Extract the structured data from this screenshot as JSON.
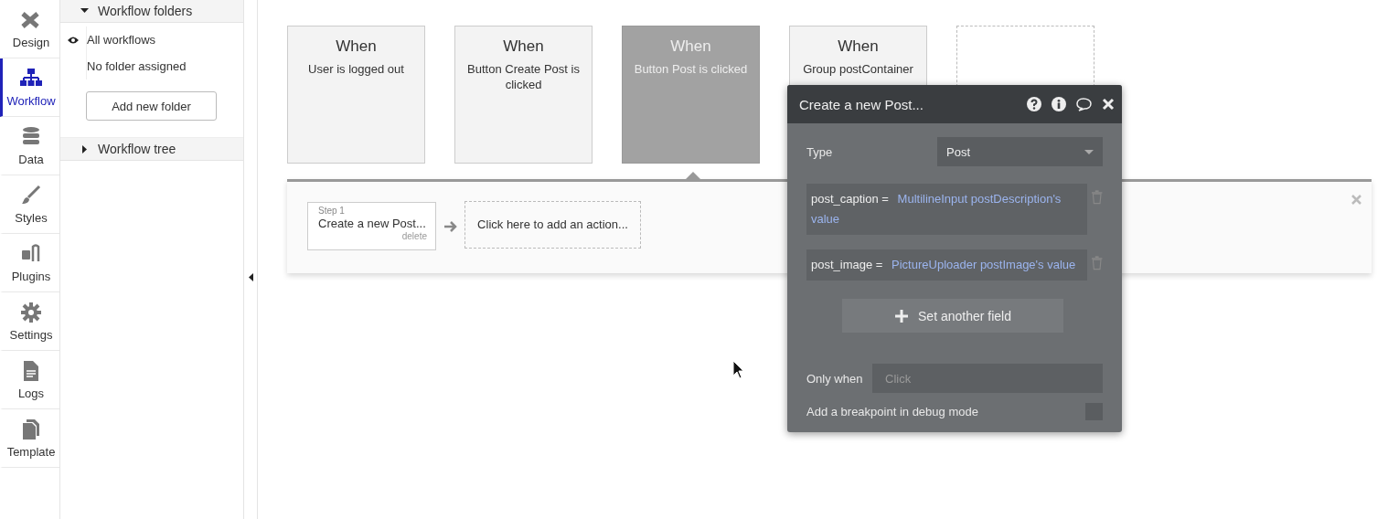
{
  "nav": [
    {
      "label": "Design",
      "selected": false
    },
    {
      "label": "Workflow",
      "selected": true
    },
    {
      "label": "Data",
      "selected": false
    },
    {
      "label": "Styles",
      "selected": false
    },
    {
      "label": "Plugins",
      "selected": false
    },
    {
      "label": "Settings",
      "selected": false
    },
    {
      "label": "Logs",
      "selected": false
    },
    {
      "label": "Template",
      "selected": false
    }
  ],
  "folders_panel": {
    "header": "Workflow folders",
    "expanded": true,
    "items": [
      {
        "label": "All workflows",
        "visible": true
      },
      {
        "label": "No folder assigned",
        "visible": false
      }
    ],
    "add_button": "Add new folder"
  },
  "tree_section": {
    "header": "Workflow tree",
    "expanded": false
  },
  "events": [
    {
      "kind": "event",
      "title": "When",
      "description": "User is logged out",
      "selected": false
    },
    {
      "kind": "event",
      "title": "When",
      "description": "Button Create Post is clicked",
      "selected": false
    },
    {
      "kind": "event",
      "title": "When",
      "description": "Button Post is clicked",
      "selected": true
    },
    {
      "kind": "event",
      "title": "When",
      "description": "Group postContainer",
      "selected": false
    },
    {
      "kind": "add"
    }
  ],
  "workflow": {
    "steps": [
      {
        "label": "Step 1",
        "title": "Create a new Post...",
        "delete": "delete"
      }
    ],
    "add_action": "Click here to add an action..."
  },
  "action_panel": {
    "title": "Create a new Post...",
    "type_label": "Type",
    "type_value": "Post",
    "fields": [
      {
        "name": "post_caption",
        "operator": "=",
        "value": "MultilineInput postDescription's value"
      },
      {
        "name": "post_image",
        "operator": "=",
        "value": "PictureUploader postImage's value"
      }
    ],
    "add_field_button": "Set another field",
    "only_when_label": "Only when",
    "only_when_placeholder": "Click",
    "breakpoint_label": "Add a breakpoint in debug mode",
    "breakpoint_checked": false
  }
}
